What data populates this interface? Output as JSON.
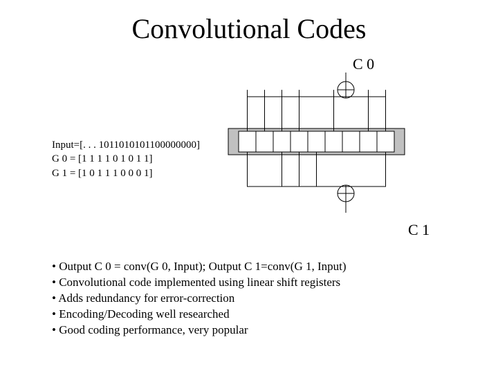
{
  "title": "Convolutional Codes",
  "labels": {
    "c0": "C 0",
    "c1": "C 1"
  },
  "params": {
    "input_line": "Input=[. . . 1011010101100000000]",
    "g0_line": "G 0 = [1 1 1 1 0 1 0 1 1]",
    "g1_line": "G 1 = [1 0 1 1 1 0 0 0 1]"
  },
  "bullets": [
    "• Output C 0 = conv(G 0, Input); Output C 1=conv(G 1, Input)",
    "• Convolutional code implemented using linear shift registers",
    "• Adds redundancy for error-correction",
    "• Encoding/Decoding well researched",
    "• Good coding performance, very popular"
  ],
  "diagram": {
    "register_cells": 9,
    "g0_taps": [
      0,
      1,
      2,
      3,
      5,
      7,
      8
    ],
    "g1_taps": [
      0,
      2,
      3,
      4,
      8
    ]
  }
}
